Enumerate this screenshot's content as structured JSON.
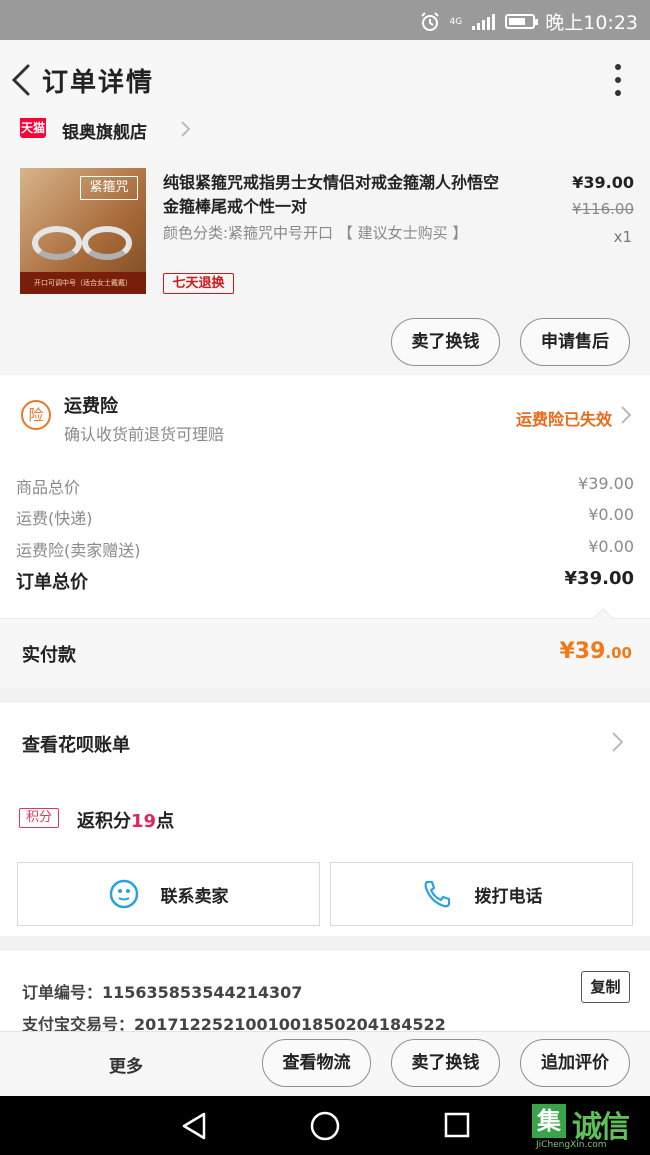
{
  "status_bar": {
    "time": "晚上10:23",
    "network": "4G"
  },
  "header": {
    "title": "订单详情"
  },
  "shop": {
    "badge": "天猫",
    "name": "银奥旗舰店"
  },
  "product": {
    "thumb_tag": "紧箍咒",
    "thumb_caption": "开口可调中号（适合女士戴戴）",
    "title": "纯银紧箍咒戒指男士女情侣对戒金箍潮人孙悟空金箍棒尾戒个性一对",
    "variant": "颜色分类:紧箍咒中号开口 【 建议女士购买 】",
    "return_badge": "七天退换",
    "price": "¥39.00",
    "original_price": "¥116.00",
    "quantity": "x1",
    "btn_buy_again": "卖了换钱",
    "btn_after_sale": "申请售后"
  },
  "insurance": {
    "icon_text": "险",
    "title": "运费险",
    "subtitle": "确认收货前退货可理赔",
    "status": "运费险已失效"
  },
  "summary": {
    "rows": [
      {
        "label": "商品总价",
        "value": "¥39.00"
      },
      {
        "label": "运费(快递)",
        "value": "¥0.00"
      },
      {
        "label": "运费险(卖家赠送)",
        "value": "¥0.00"
      }
    ],
    "total_label": "订单总价",
    "total_value": "¥39.00"
  },
  "paid": {
    "label": "实付款",
    "amount_main": "¥39",
    "amount_decimal": ".00"
  },
  "huabei": {
    "title": "查看花呗账单"
  },
  "points": {
    "badge": "积分",
    "prefix": "返积分",
    "value": "19",
    "suffix": "点"
  },
  "contact": {
    "seller": "联系卖家",
    "phone": "拨打电话"
  },
  "order_info": {
    "order_no": "订单编号：115635853544214307",
    "alipay_no": "支付宝交易号：2017122521001001850204184522",
    "copy": "复制"
  },
  "actions": {
    "more": "更多",
    "logistics": "查看物流",
    "sell": "卖了换钱",
    "review": "追加评价"
  },
  "watermark": {
    "box": "集",
    "text": "诚信",
    "sub": "JiChengXin.com"
  },
  "colors": {
    "accent_orange": "#f07a1a",
    "tmall_red": "#ff0036",
    "points_red": "#e0245e"
  }
}
